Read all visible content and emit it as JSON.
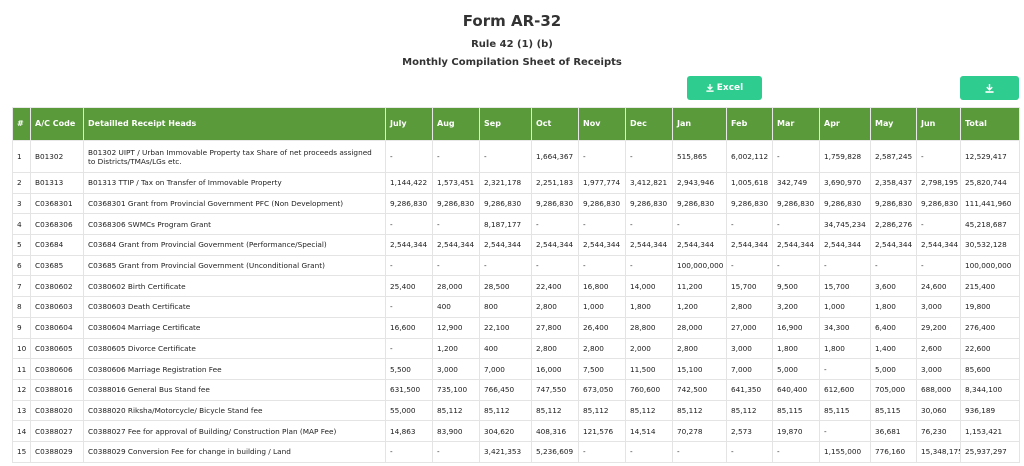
{
  "header": {
    "title": "Form AR-32",
    "rule": "Rule 42 (1) (b)",
    "subtitle": "Monthly Compilation Sheet of Receipts"
  },
  "toolbar": {
    "excel_label": "Excel",
    "excel_icon": "download-icon",
    "download_icon": "download-icon"
  },
  "colors": {
    "accent": "#2ecc8f",
    "table_header": "#5a9a3b"
  },
  "table": {
    "columns": [
      "#",
      "A/C Code",
      "Detailled Receipt Heads",
      "July",
      "Aug",
      "Sep",
      "Oct",
      "Nov",
      "Dec",
      "Jan",
      "Feb",
      "Mar",
      "Apr",
      "May",
      "Jun",
      "Total"
    ],
    "rows": [
      [
        "1",
        "B01302",
        "B01302 UIPT / Urban Immovable Property tax Share of net proceeds assigned to Districts/TMAs/LGs etc.",
        "-",
        "-",
        "-",
        "1,664,367",
        "-",
        "-",
        "515,865",
        "6,002,112",
        "-",
        "1,759,828",
        "2,587,245",
        "-",
        "12,529,417"
      ],
      [
        "2",
        "B01313",
        "B01313 TTIP / Tax on Transfer of Immovable Property",
        "1,144,422",
        "1,573,451",
        "2,321,178",
        "2,251,183",
        "1,977,774",
        "3,412,821",
        "2,943,946",
        "1,005,618",
        "342,749",
        "3,690,970",
        "2,358,437",
        "2,798,195",
        "25,820,744"
      ],
      [
        "3",
        "C0368301",
        "C0368301 Grant from Provincial Government PFC (Non Development)",
        "9,286,830",
        "9,286,830",
        "9,286,830",
        "9,286,830",
        "9,286,830",
        "9,286,830",
        "9,286,830",
        "9,286,830",
        "9,286,830",
        "9,286,830",
        "9,286,830",
        "9,286,830",
        "111,441,960"
      ],
      [
        "4",
        "C0368306",
        "C0368306 SWMCs Program Grant",
        "-",
        "-",
        "8,187,177",
        "-",
        "-",
        "-",
        "-",
        "-",
        "-",
        "34,745,234",
        "2,286,276",
        "-",
        "45,218,687"
      ],
      [
        "5",
        "C03684",
        "C03684 Grant from Provincial Government (Performance/Special)",
        "2,544,344",
        "2,544,344",
        "2,544,344",
        "2,544,344",
        "2,544,344",
        "2,544,344",
        "2,544,344",
        "2,544,344",
        "2,544,344",
        "2,544,344",
        "2,544,344",
        "2,544,344",
        "30,532,128"
      ],
      [
        "6",
        "C03685",
        "C03685 Grant from Provincial Government (Unconditional Grant)",
        "-",
        "-",
        "-",
        "-",
        "-",
        "-",
        "100,000,000",
        "-",
        "-",
        "-",
        "-",
        "-",
        "100,000,000"
      ],
      [
        "7",
        "C0380602",
        "C0380602 Birth Certificate",
        "25,400",
        "28,000",
        "28,500",
        "22,400",
        "16,800",
        "14,000",
        "11,200",
        "15,700",
        "9,500",
        "15,700",
        "3,600",
        "24,600",
        "215,400"
      ],
      [
        "8",
        "C0380603",
        "C0380603 Death Certificate",
        "-",
        "400",
        "800",
        "2,800",
        "1,000",
        "1,800",
        "1,200",
        "2,800",
        "3,200",
        "1,000",
        "1,800",
        "3,000",
        "19,800"
      ],
      [
        "9",
        "C0380604",
        "C0380604 Marriage Certificate",
        "16,600",
        "12,900",
        "22,100",
        "27,800",
        "26,400",
        "28,800",
        "28,000",
        "27,000",
        "16,900",
        "34,300",
        "6,400",
        "29,200",
        "276,400"
      ],
      [
        "10",
        "C0380605",
        "C0380605 Divorce Certificate",
        "-",
        "1,200",
        "400",
        "2,800",
        "2,800",
        "2,000",
        "2,800",
        "3,000",
        "1,800",
        "1,800",
        "1,400",
        "2,600",
        "22,600"
      ],
      [
        "11",
        "C0380606",
        "C0380606 Marriage Registration Fee",
        "5,500",
        "3,000",
        "7,000",
        "16,000",
        "7,500",
        "11,500",
        "15,100",
        "7,000",
        "5,000",
        "-",
        "5,000",
        "3,000",
        "85,600"
      ],
      [
        "12",
        "C0388016",
        "C0388016 General Bus Stand fee",
        "631,500",
        "735,100",
        "766,450",
        "747,550",
        "673,050",
        "760,600",
        "742,500",
        "641,350",
        "640,400",
        "612,600",
        "705,000",
        "688,000",
        "8,344,100"
      ],
      [
        "13",
        "C0388020",
        "C0388020 Riksha/Motorcycle/ Bicycle Stand fee",
        "55,000",
        "85,112",
        "85,112",
        "85,112",
        "85,112",
        "85,112",
        "85,112",
        "85,112",
        "85,115",
        "85,115",
        "85,115",
        "30,060",
        "936,189"
      ],
      [
        "14",
        "C0388027",
        "C0388027 Fee for approval of Building/ Construction Plan (MAP Fee)",
        "14,863",
        "83,900",
        "304,620",
        "408,316",
        "121,576",
        "14,514",
        "70,278",
        "2,573",
        "19,870",
        "-",
        "36,681",
        "76,230",
        "1,153,421"
      ],
      [
        "15",
        "C0388029",
        "C0388029 Conversion Fee for change in building / Land",
        "-",
        "-",
        "3,421,353",
        "5,236,609",
        "-",
        "-",
        "-",
        "-",
        "-",
        "1,155,000",
        "776,160",
        "15,348,175",
        "25,937,297"
      ]
    ]
  }
}
